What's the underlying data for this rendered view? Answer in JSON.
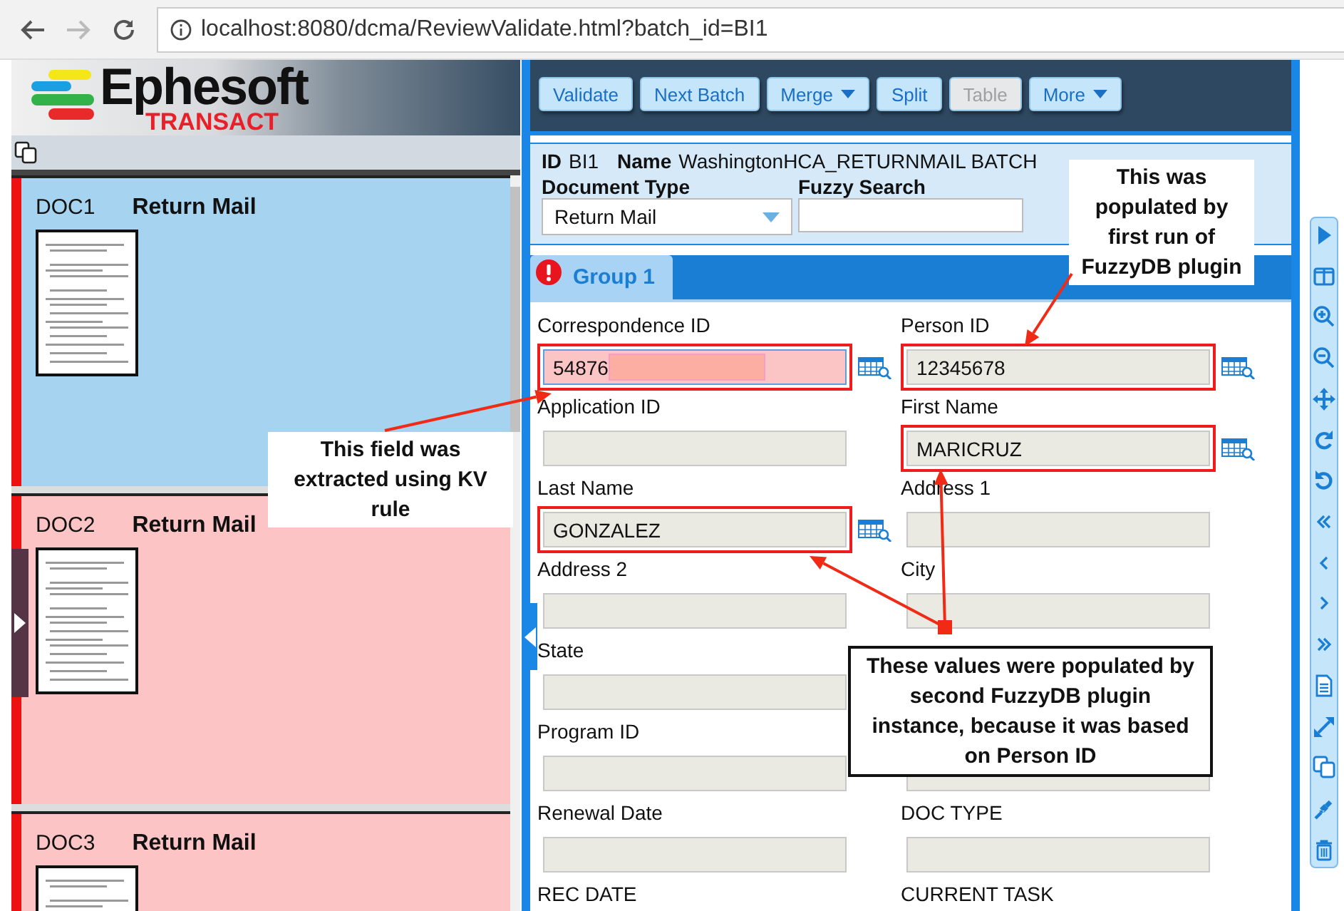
{
  "browser": {
    "url": "localhost:8080/dcma/ReviewValidate.html?batch_id=BI1"
  },
  "logo": {
    "name": "Ephesoft",
    "product": "TRANSACT"
  },
  "documents": [
    {
      "id": "DOC1",
      "type": "Return Mail",
      "selected": true
    },
    {
      "id": "DOC2",
      "type": "Return Mail",
      "selected": false
    },
    {
      "id": "DOC3",
      "type": "Return Mail",
      "selected": false
    }
  ],
  "toolbar_buttons": [
    {
      "label": "Validate",
      "disabled": false,
      "dropdown": false
    },
    {
      "label": "Next Batch",
      "disabled": false,
      "dropdown": false
    },
    {
      "label": "Merge",
      "disabled": false,
      "dropdown": true
    },
    {
      "label": "Split",
      "disabled": false,
      "dropdown": false
    },
    {
      "label": "Table",
      "disabled": true,
      "dropdown": false
    },
    {
      "label": "More",
      "disabled": false,
      "dropdown": true
    }
  ],
  "batch": {
    "id_label": "ID",
    "id": "BI1",
    "name_label": "Name",
    "name": "WashingtonHCA_RETURNMAIL BATCH"
  },
  "document_type": {
    "label": "Document Type",
    "value": "Return Mail"
  },
  "fuzzy_search": {
    "label": "Fuzzy Search"
  },
  "tabs": [
    {
      "label": "Group 1",
      "selected": true,
      "error": true
    }
  ],
  "fields": [
    {
      "label": "Correspondence ID",
      "value": "54876",
      "invalid": true,
      "redacted": true,
      "highlighted": true,
      "lookup": true
    },
    {
      "label": "Person ID",
      "value": "12345678",
      "invalid": false,
      "redacted": false,
      "highlighted": true,
      "lookup": true
    },
    {
      "label": "Application ID",
      "invalid": false,
      "redacted": false,
      "highlighted": false,
      "lookup": false
    },
    {
      "label": "First Name",
      "value": "MARICRUZ",
      "invalid": false,
      "redacted": false,
      "highlighted": true,
      "lookup": true
    },
    {
      "label": "Last Name",
      "value": "GONZALEZ",
      "invalid": false,
      "redacted": false,
      "highlighted": true,
      "lookup": true
    },
    {
      "label": "Address 1",
      "invalid": false,
      "redacted": false,
      "highlighted": false,
      "lookup": false
    },
    {
      "label": "Address 2",
      "invalid": false,
      "redacted": false,
      "highlighted": false,
      "lookup": false
    },
    {
      "label": "City",
      "invalid": false,
      "redacted": false,
      "highlighted": false,
      "lookup": false
    },
    {
      "label": "State",
      "invalid": false,
      "redacted": false,
      "highlighted": false,
      "lookup": false
    },
    {
      "label": "Program ID",
      "invalid": false,
      "redacted": false,
      "highlighted": false,
      "lookup": false
    },
    {
      "invalid": false,
      "redacted": false,
      "highlighted": false,
      "lookup": false
    },
    {
      "label": "Renewal Date",
      "invalid": false,
      "redacted": false,
      "highlighted": false,
      "lookup": false
    },
    {
      "label": "DOC TYPE",
      "invalid": false,
      "redacted": false,
      "highlighted": false,
      "lookup": false
    },
    {
      "label": "REC DATE"
    },
    {
      "label": "CURRENT TASK"
    }
  ],
  "callouts": [
    {
      "text": "This was populated by first run of FuzzyDB plugin",
      "bordered": false
    },
    {
      "text": "This field was extracted using KV rule",
      "bordered": false
    },
    {
      "text": "These values were populated by second FuzzyDB plugin instance, because it was based on Person ID",
      "bordered": true
    }
  ]
}
